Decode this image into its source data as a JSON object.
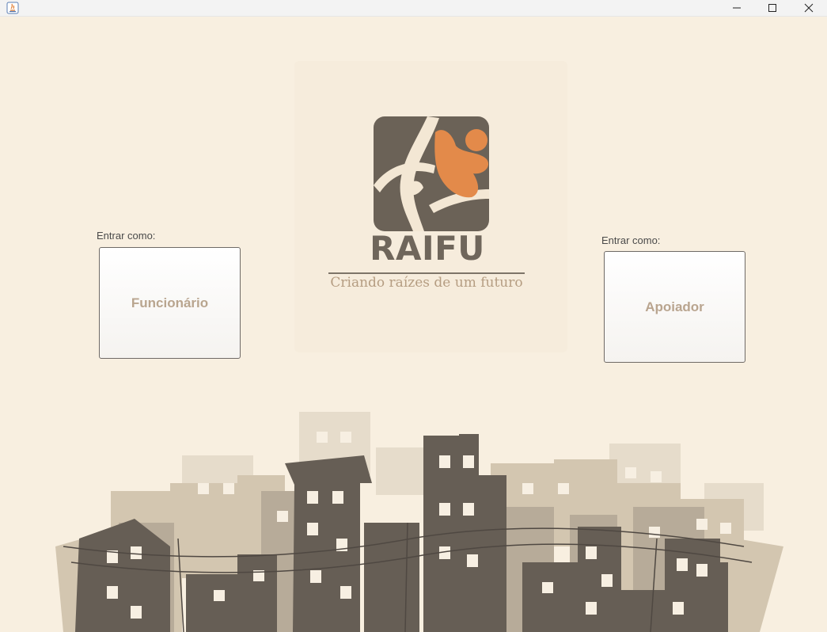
{
  "window": {
    "title": "",
    "controls": [
      "minimize-icon",
      "maximize-icon",
      "close-icon"
    ]
  },
  "brand": {
    "name": "RAIFU",
    "tagline": "Criando raízes de um futuro"
  },
  "login": {
    "left": {
      "label": "Entrar como:",
      "button": "Funcionário"
    },
    "right": {
      "label": "Entrar como:",
      "button": "Apoiador"
    }
  },
  "colors": {
    "background": "#f8efe0",
    "logo_dark": "#6b6257",
    "logo_accent": "#e38a4a",
    "button_text": "#b9a58f",
    "skyline_dark": "#665e55",
    "skyline_mid": "#b7ab99",
    "skyline_light": "#d8ccb7"
  }
}
